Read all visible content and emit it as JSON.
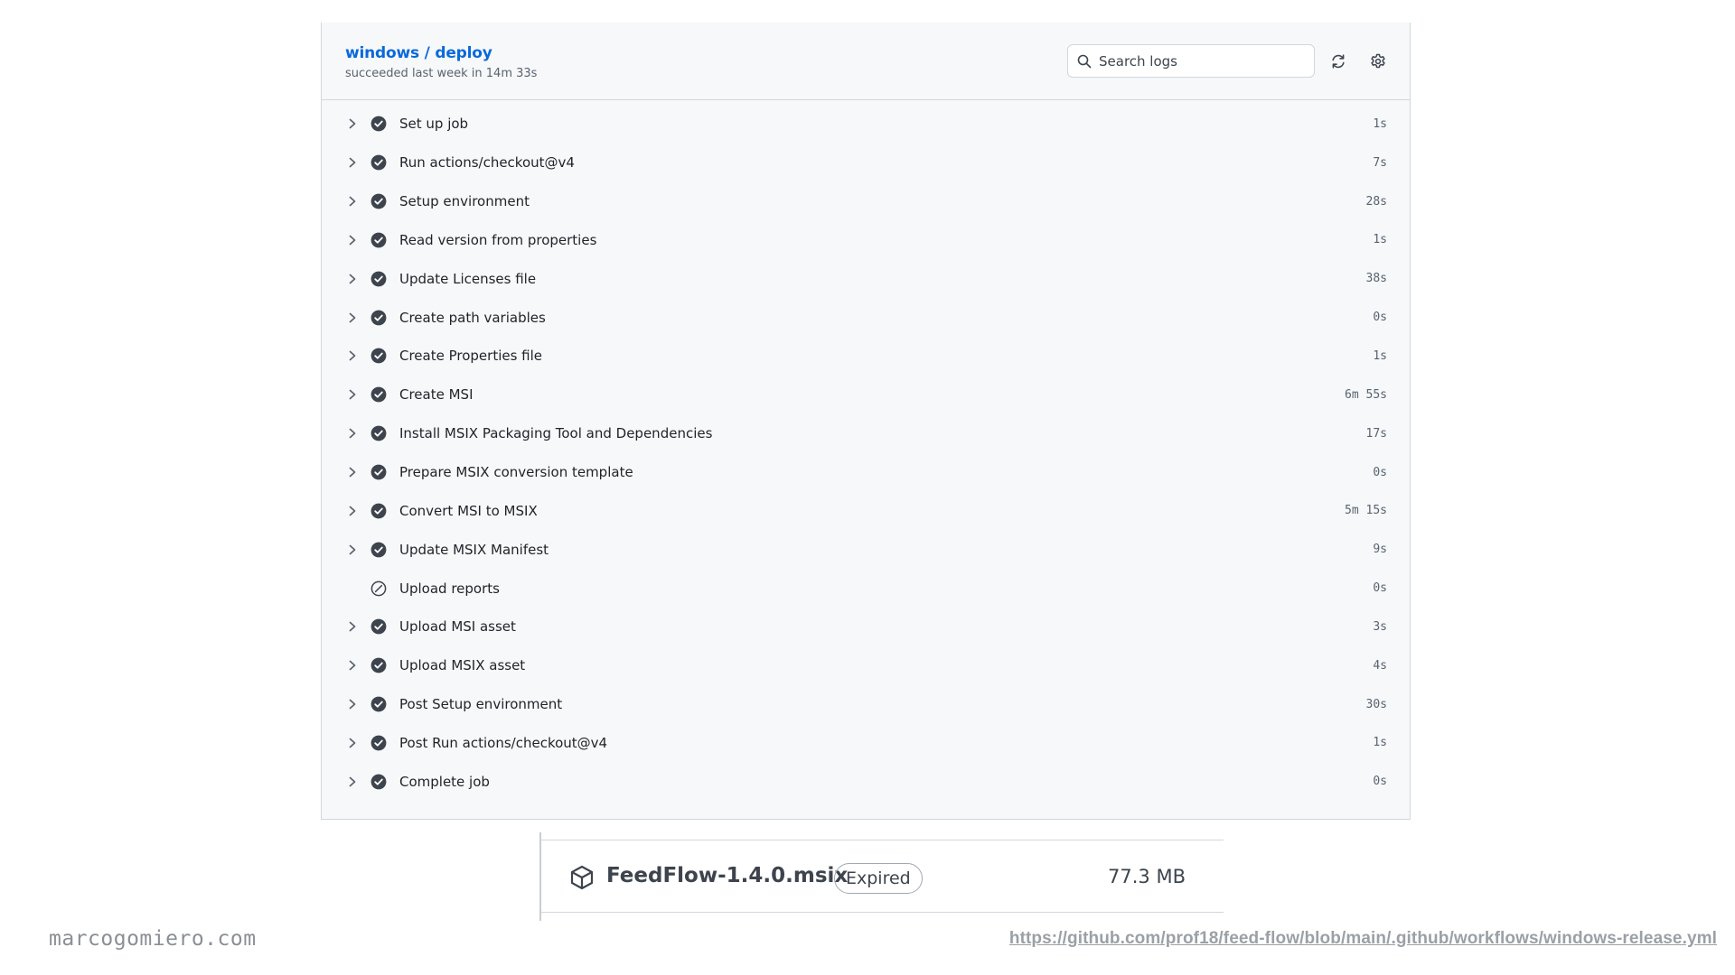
{
  "job": {
    "title": "windows / deploy",
    "subtitle": "succeeded last week in 14m 33s"
  },
  "search": {
    "placeholder": "Search logs"
  },
  "icons": {
    "refresh": "refresh-icon",
    "settings": "gear-icon",
    "success": "check-circle-fill-icon",
    "skipped": "skip-icon",
    "chevron": "chevron-right-icon",
    "package": "package-icon"
  },
  "steps": [
    {
      "name": "Set up job",
      "duration": "1s",
      "status": "success"
    },
    {
      "name": "Run actions/checkout@v4",
      "duration": "7s",
      "status": "success"
    },
    {
      "name": "Setup environment",
      "duration": "28s",
      "status": "success"
    },
    {
      "name": "Read version from properties",
      "duration": "1s",
      "status": "success"
    },
    {
      "name": "Update Licenses file",
      "duration": "38s",
      "status": "success"
    },
    {
      "name": "Create path variables",
      "duration": "0s",
      "status": "success"
    },
    {
      "name": "Create Properties file",
      "duration": "1s",
      "status": "success"
    },
    {
      "name": "Create MSI",
      "duration": "6m 55s",
      "status": "success"
    },
    {
      "name": "Install MSIX Packaging Tool and Dependencies",
      "duration": "17s",
      "status": "success"
    },
    {
      "name": "Prepare MSIX conversion template",
      "duration": "0s",
      "status": "success"
    },
    {
      "name": "Convert MSI to MSIX",
      "duration": "5m 15s",
      "status": "success"
    },
    {
      "name": "Update MSIX Manifest",
      "duration": "9s",
      "status": "success"
    },
    {
      "name": "Upload reports",
      "duration": "0s",
      "status": "skipped"
    },
    {
      "name": "Upload MSI asset",
      "duration": "3s",
      "status": "success"
    },
    {
      "name": "Upload MSIX asset",
      "duration": "4s",
      "status": "success"
    },
    {
      "name": "Post Setup environment",
      "duration": "30s",
      "status": "success"
    },
    {
      "name": "Post Run actions/checkout@v4",
      "duration": "1s",
      "status": "success"
    },
    {
      "name": "Complete job",
      "duration": "0s",
      "status": "success"
    }
  ],
  "artifact": {
    "name": "FeedFlow-1.4.0.msix",
    "badge": "Expired",
    "size": "77.3 MB"
  },
  "footer": {
    "site": "marcogomiero.com",
    "link": "https://github.com/prof18/feed-flow/blob/main/.github/workflows/windows-release.yml"
  },
  "colors": {
    "link_blue": "#0969da",
    "status_icon": "#3d444d",
    "panel_bg": "#f6f8fa",
    "border": "#d0d7de"
  }
}
